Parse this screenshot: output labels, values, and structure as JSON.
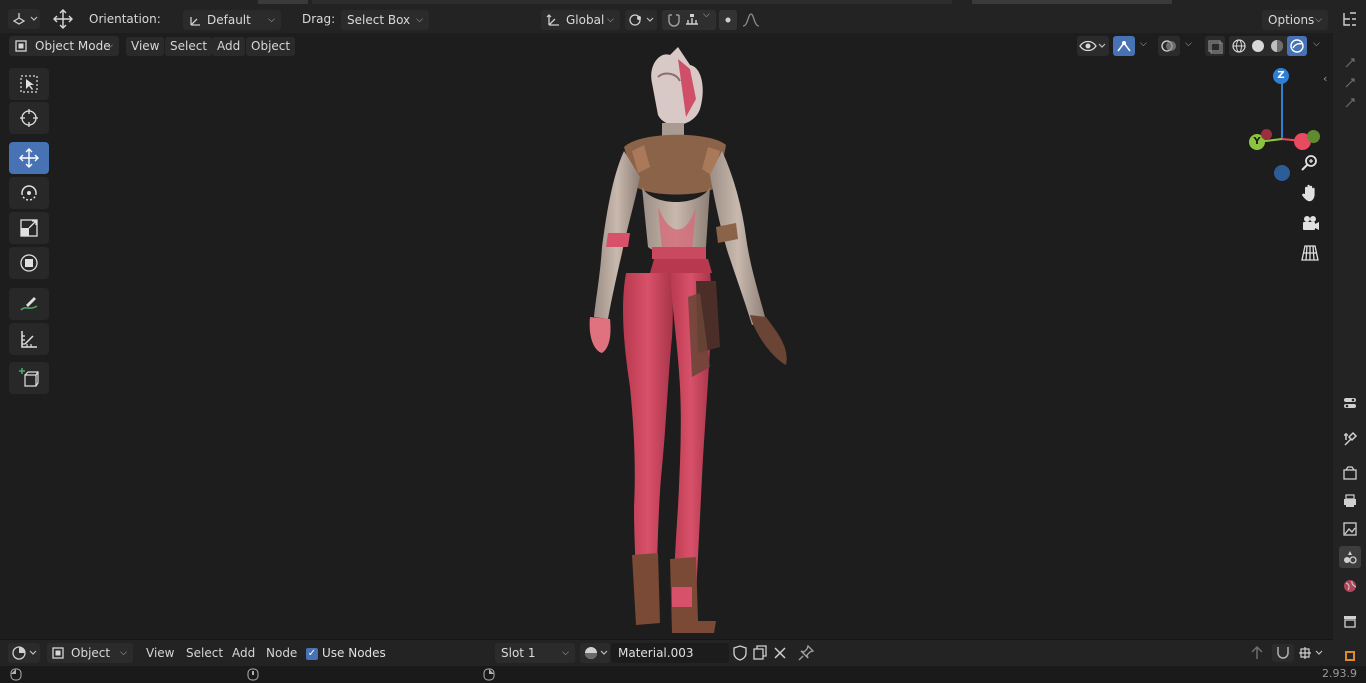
{
  "top_header": {
    "orientation_label": "Orientation:",
    "orientation_value": "Default",
    "drag_label": "Drag:",
    "drag_value": "Select Box",
    "transform_space": "Global",
    "options_label": "Options"
  },
  "view_header": {
    "mode": "Object Mode",
    "menus": [
      "View",
      "Select",
      "Add",
      "Object"
    ]
  },
  "toolbar": {
    "tools": [
      "select-box",
      "cursor",
      "move",
      "rotate",
      "scale",
      "transform",
      "annotate",
      "measure",
      "add-cube"
    ],
    "active_tool": "move"
  },
  "gizmo": {
    "z_label": "Z",
    "y_label": "Y",
    "colors": {
      "x": "#e84a5f",
      "y": "#8bc53f",
      "z": "#2f7fd5"
    }
  },
  "bottom_header": {
    "mode": "Object",
    "menus": [
      "View",
      "Select",
      "Add",
      "Node"
    ],
    "use_nodes_label": "Use Nodes",
    "use_nodes_checked": true,
    "slot": "Slot 1",
    "material_name": "Material.003"
  },
  "status_bar": {
    "version": "2.93.9"
  },
  "colors": {
    "accent": "#4772b3",
    "viewport_bg": "#1d1d1d",
    "header_bg": "#232323"
  }
}
